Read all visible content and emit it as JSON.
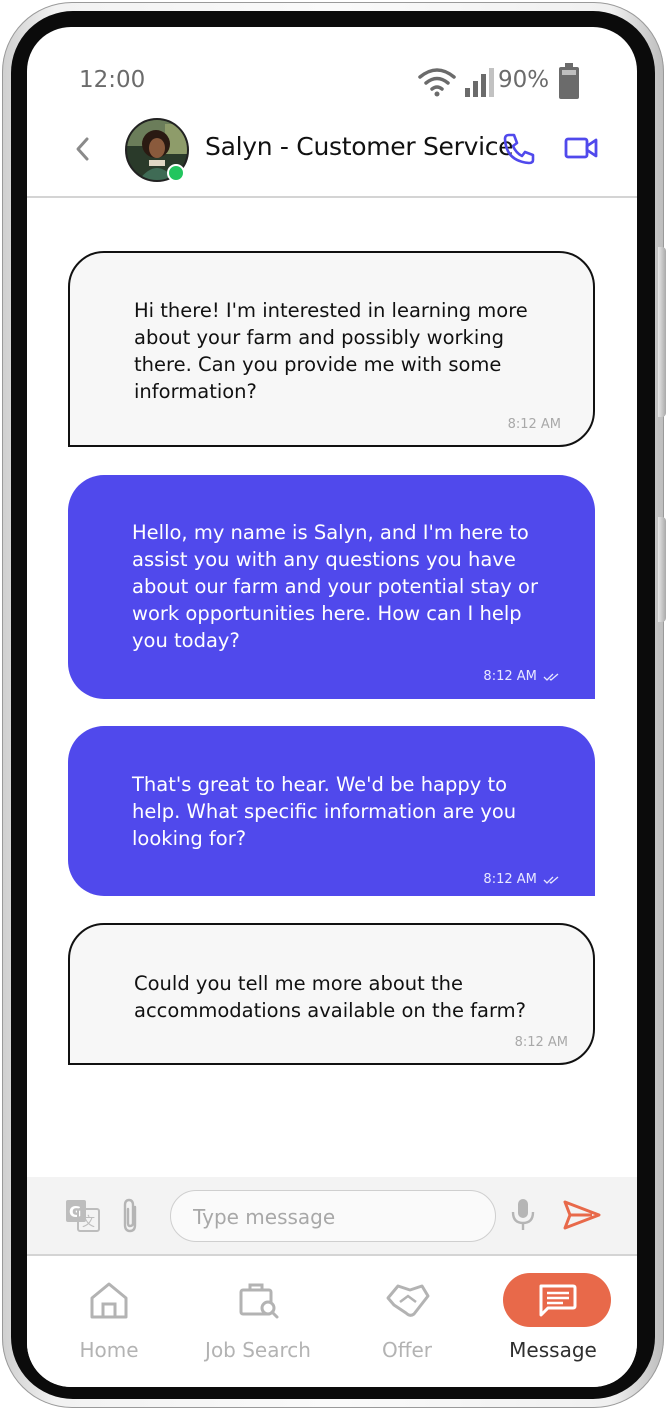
{
  "status_bar": {
    "time": "12:00",
    "battery": "90%"
  },
  "header": {
    "back_icon": "chevron-left-icon",
    "contact_name": "Salyn - Customer Service",
    "online": true,
    "colors": {
      "accent": "#5049ec",
      "online": "#22c55e"
    }
  },
  "messages": [
    {
      "direction": "incoming",
      "text": "Hi there! I'm interested in learning more about your farm and possibly working there. Can you provide me with some information?",
      "time": "8:12 AM"
    },
    {
      "direction": "outgoing",
      "text": "Hello, my name is Salyn, and I'm here to assist you with any questions you have about our farm and your potential stay or work opportunities here. How can I help you today?",
      "time": "8:12 AM",
      "read": true
    },
    {
      "direction": "outgoing",
      "text": "That's great to hear. We'd be happy to help. What specific information are you looking for?",
      "time": "8:12 AM",
      "read": true
    },
    {
      "direction": "incoming",
      "text": "Could you tell me more about the accommodations available on the farm?",
      "time": "8:12 AM"
    }
  ],
  "composer": {
    "placeholder": "Type message",
    "value": "",
    "send_color": "#e8694a"
  },
  "nav": {
    "items": [
      {
        "label": "Home",
        "icon": "home-icon"
      },
      {
        "label": "Job Search",
        "icon": "job-search-icon"
      },
      {
        "label": "Offer",
        "icon": "handshake-icon"
      },
      {
        "label": "Message",
        "icon": "message-icon",
        "active": true
      }
    ],
    "active_color": "#e8694a"
  }
}
